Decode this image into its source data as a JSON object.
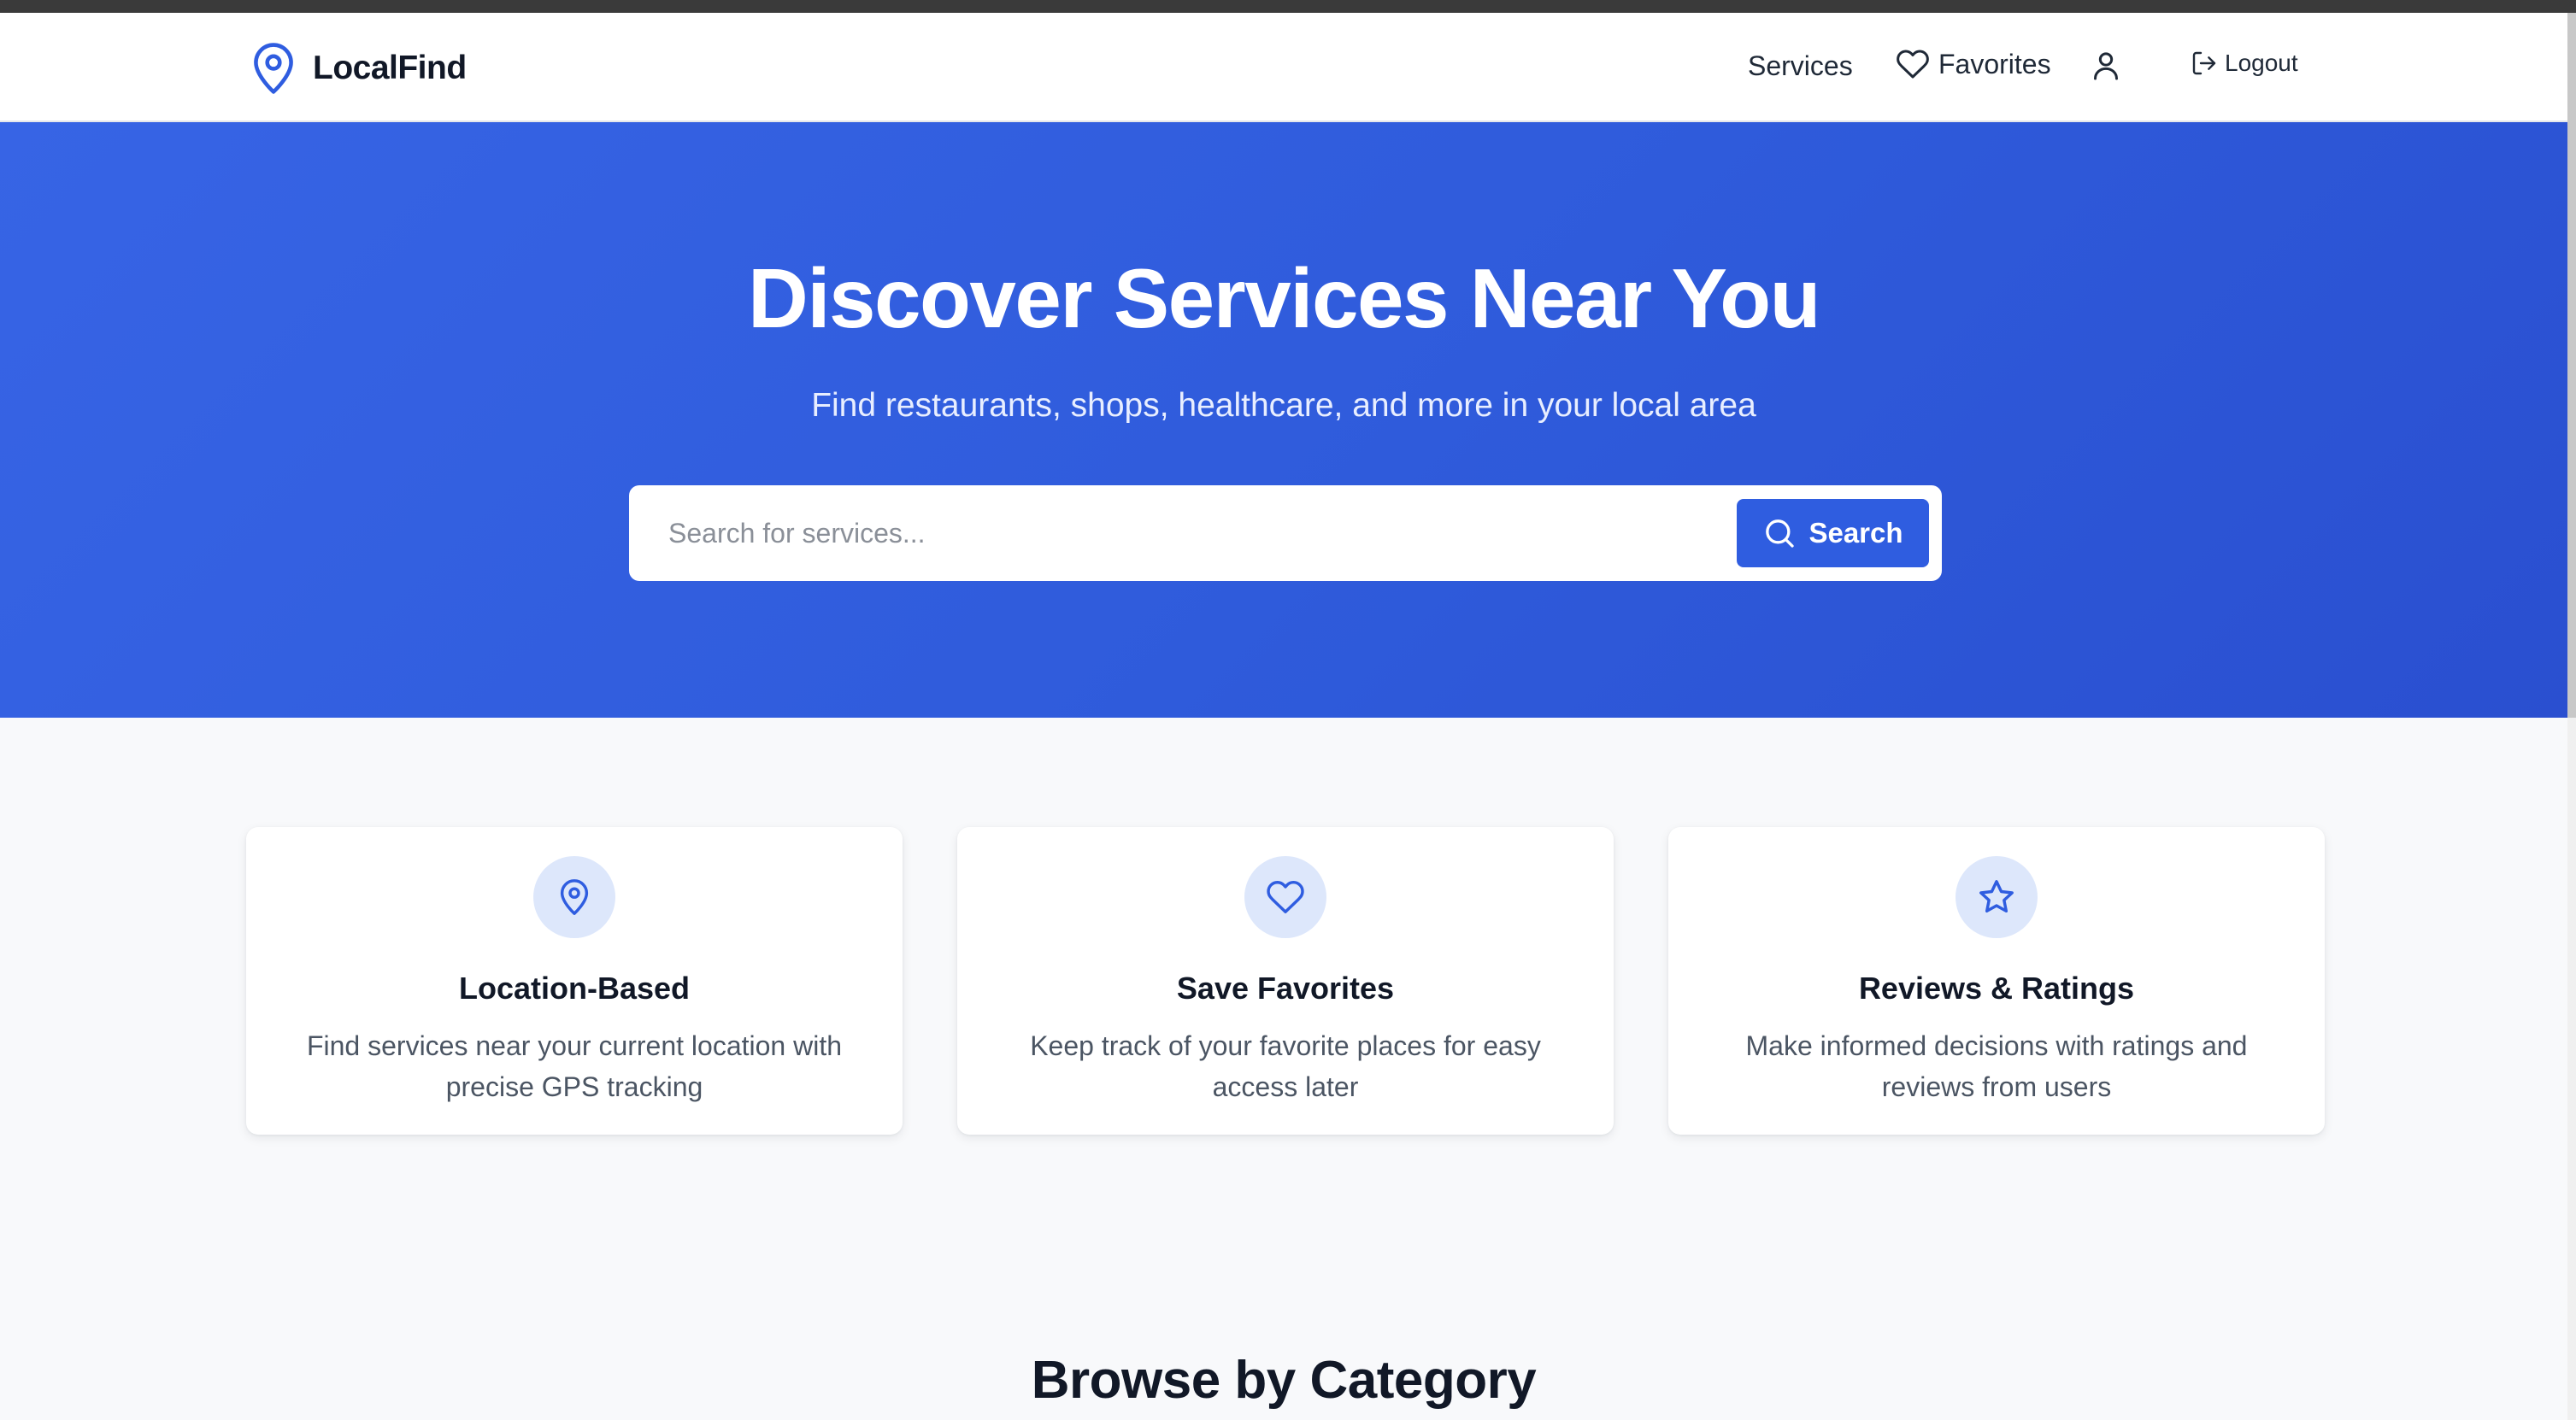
{
  "brand": {
    "name": "LocalFind",
    "icon": "map-pin-icon",
    "color": "#2f5de0"
  },
  "nav": {
    "services_label": "Services",
    "favorites_label": "Favorites",
    "favorites_icon": "heart-icon",
    "user_icon": "user-icon",
    "logout_label": "Logout",
    "logout_icon": "logout-icon"
  },
  "hero": {
    "title": "Discover Services Near You",
    "subtitle": "Find restaurants, shops, healthcare, and more in your local area",
    "background": "#3264e0"
  },
  "search": {
    "placeholder": "Search for services...",
    "value": "",
    "button_label": "Search",
    "button_icon": "search-icon"
  },
  "features": [
    {
      "icon": "map-pin-icon",
      "title": "Location-Based",
      "description": "Find services near your current location with precise GPS tracking"
    },
    {
      "icon": "heart-icon",
      "title": "Save Favorites",
      "description": "Keep track of your favorite places for easy access later"
    },
    {
      "icon": "star-icon",
      "title": "Reviews & Ratings",
      "description": "Make informed decisions with ratings and reviews from users"
    }
  ],
  "browse": {
    "title": "Browse by Category"
  },
  "colors": {
    "accent": "#2f5de0",
    "icon_bg": "#dde7fb",
    "page_bg": "#f8f9fb"
  }
}
